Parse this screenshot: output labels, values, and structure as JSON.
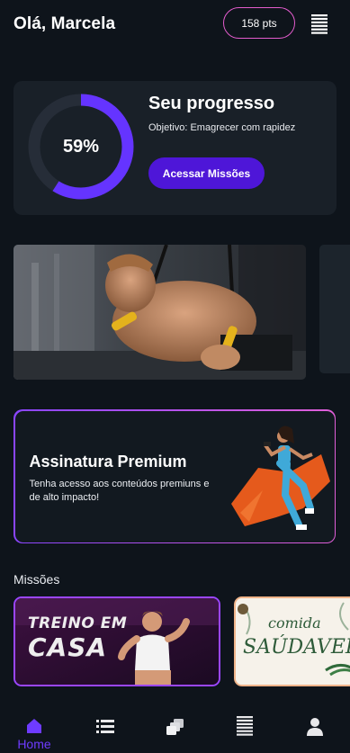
{
  "header": {
    "greeting": "Olá, Marcela",
    "points": "158 pts",
    "ranking_icon": "ranking-bars-icon"
  },
  "progress": {
    "title": "Seu progresso",
    "goal": "Objetivo: Emagrecer com rapidez",
    "percent_text": "59%",
    "percent_value": 0.59,
    "button_label": "Acessar Missões",
    "colors": {
      "ring": "#6534ff",
      "track": "#262d38",
      "button": "#4e16d8"
    }
  },
  "banner": {
    "subject": "man training with suspension straps in gym"
  },
  "premium": {
    "title": "Assinatura Premium",
    "description": "Tenha acesso aos conteúdos premiuns e de alto impacto!",
    "border_gradient": [
      "#8a45ff",
      "#e05fd8"
    ]
  },
  "missions": {
    "section_title": "Missões",
    "cards": [
      {
        "line1": "TREINO EM",
        "line2": "CASA"
      },
      {
        "line1": "comida",
        "line2": "SAÚDAVEL"
      }
    ]
  },
  "nav": {
    "items": [
      {
        "icon": "home-icon",
        "label": "Home",
        "active": true
      },
      {
        "icon": "list-icon",
        "label": "",
        "active": false
      },
      {
        "icon": "cards-icon",
        "label": "",
        "active": false
      },
      {
        "icon": "ranking-icon",
        "label": "",
        "active": false
      },
      {
        "icon": "profile-icon",
        "label": "",
        "active": false
      }
    ],
    "active_color": "#6e3bff"
  }
}
